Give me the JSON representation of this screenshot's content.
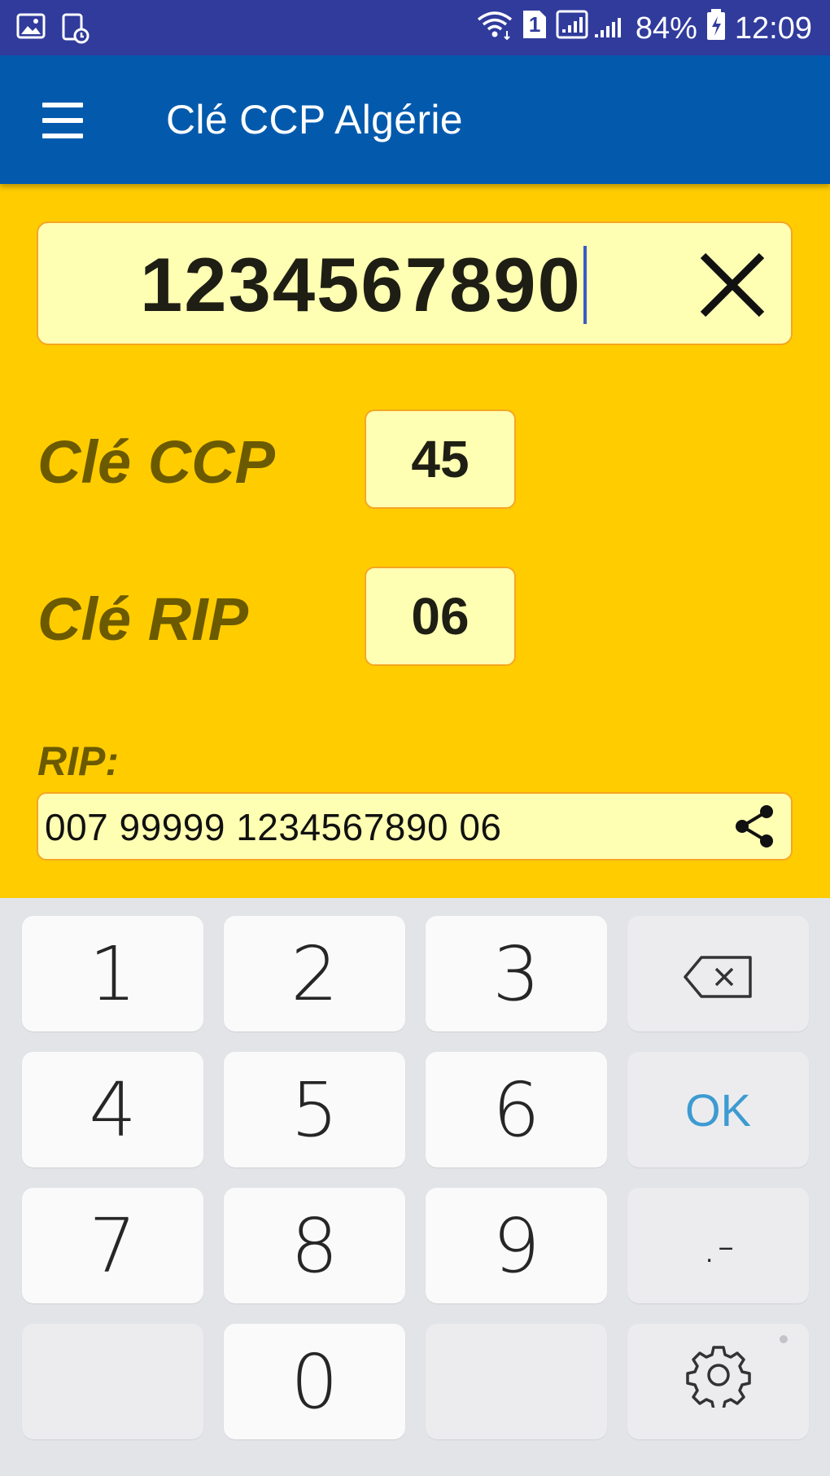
{
  "status_bar": {
    "battery": "84%",
    "time": "12:09",
    "sim_slot": "1"
  },
  "app_bar": {
    "title": "Clé CCP Algérie"
  },
  "input": {
    "value": "1234567890"
  },
  "results": {
    "ccp_label": "Clé CCP",
    "ccp_value": "45",
    "rip_key_label": "Clé RIP",
    "rip_key_value": "06",
    "rip_label": "RIP:",
    "rip_value": "007 99999 1234567890 06"
  },
  "keypad": {
    "k1": "1",
    "k2": "2",
    "k3": "3",
    "k4": "4",
    "k5": "5",
    "k6": "6",
    "k7": "7",
    "k8": "8",
    "k9": "9",
    "k0": "0",
    "ok": "OK",
    "punct": ".-"
  },
  "colors": {
    "status_bar": "#303b9c",
    "app_bar": "#035aad",
    "background": "#ffcc00",
    "field": "#ffffb3",
    "field_border": "#f5a623",
    "label": "#6b5a00",
    "ok_key": "#3d9bd1"
  },
  "icons": [
    "gallery-icon",
    "screenshot-icon",
    "wifi-icon",
    "sim-icon",
    "signal-icon",
    "battery-charging-icon",
    "menu-icon",
    "clear-icon",
    "share-icon",
    "backspace-icon",
    "settings-icon"
  ]
}
